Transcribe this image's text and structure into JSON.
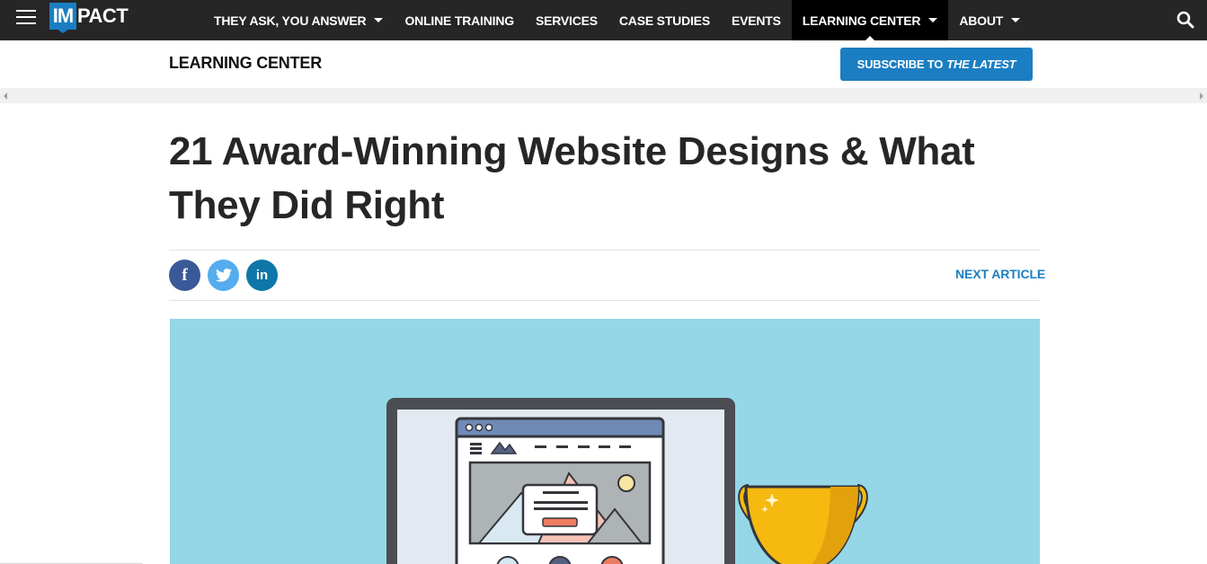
{
  "logo": {
    "box_text": "IM",
    "rest_text": "PACT"
  },
  "nav": {
    "items": [
      {
        "label": "THEY ASK, YOU ANSWER",
        "has_caret": true
      },
      {
        "label": "ONLINE TRAINING",
        "has_caret": false
      },
      {
        "label": "SERVICES",
        "has_caret": false
      },
      {
        "label": "CASE STUDIES",
        "has_caret": false
      },
      {
        "label": "EVENTS",
        "has_caret": false
      },
      {
        "label": "LEARNING CENTER",
        "has_caret": true,
        "active": true
      },
      {
        "label": "ABOUT",
        "has_caret": true
      }
    ]
  },
  "subheader": {
    "title": "LEARNING CENTER",
    "subscribe_label": "SUBSCRIBE TO",
    "subscribe_emphasis": "THE LATEST"
  },
  "article": {
    "title": "21 Award-Winning Website Designs & What They Did Right",
    "next_article": "NEXT ARTICLE"
  },
  "share": {
    "facebook": "f",
    "twitter": "twitter-bird-icon",
    "linkedin": "in"
  },
  "colors": {
    "nav_bg": "#262626",
    "nav_active_bg": "#000000",
    "accent_blue": "#1b7ec2",
    "facebook": "#3b5998",
    "twitter": "#55acee",
    "linkedin": "#0e76a8",
    "hero_bg": "#95d7e7",
    "trophy": "#f5b90f"
  }
}
